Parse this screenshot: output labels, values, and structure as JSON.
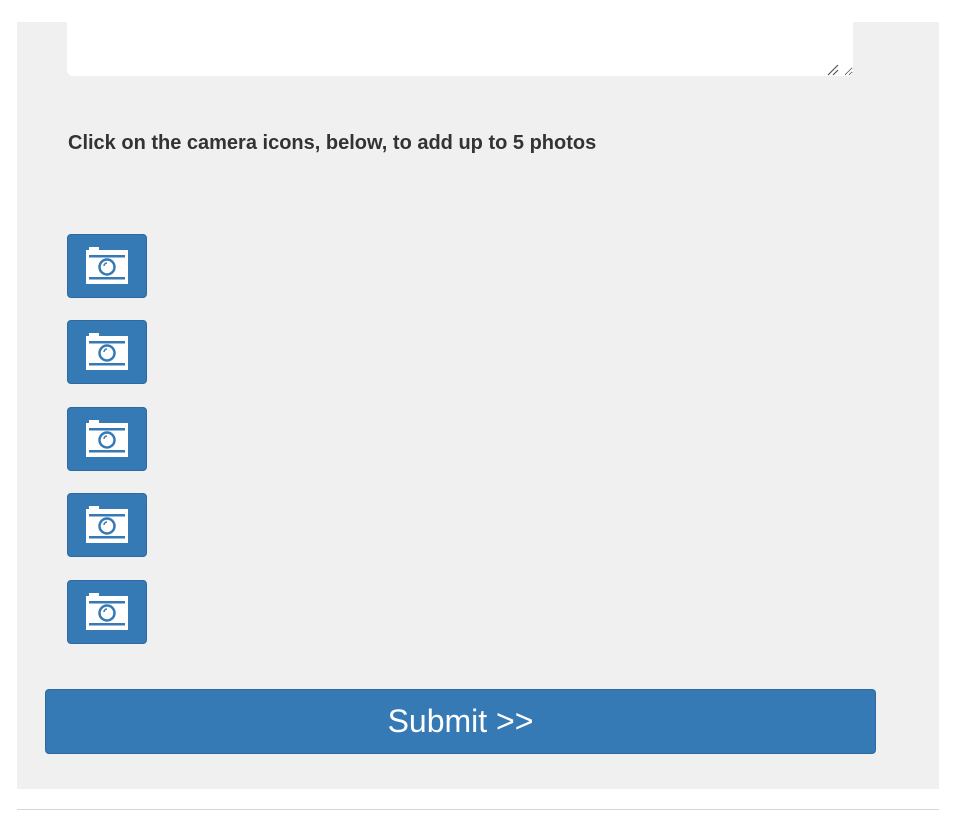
{
  "form": {
    "description_value": "",
    "instructions": "Click on the camera icons, below, to add up to 5 photos",
    "photo_slots": [
      {
        "icon": "camera-icon"
      },
      {
        "icon": "camera-icon"
      },
      {
        "icon": "camera-icon"
      },
      {
        "icon": "camera-icon"
      },
      {
        "icon": "camera-icon"
      }
    ],
    "submit_label": "Submit >>"
  },
  "colors": {
    "panel_background": "#f0f0f0",
    "button_blue": "#3579b5",
    "text": "#333333"
  }
}
